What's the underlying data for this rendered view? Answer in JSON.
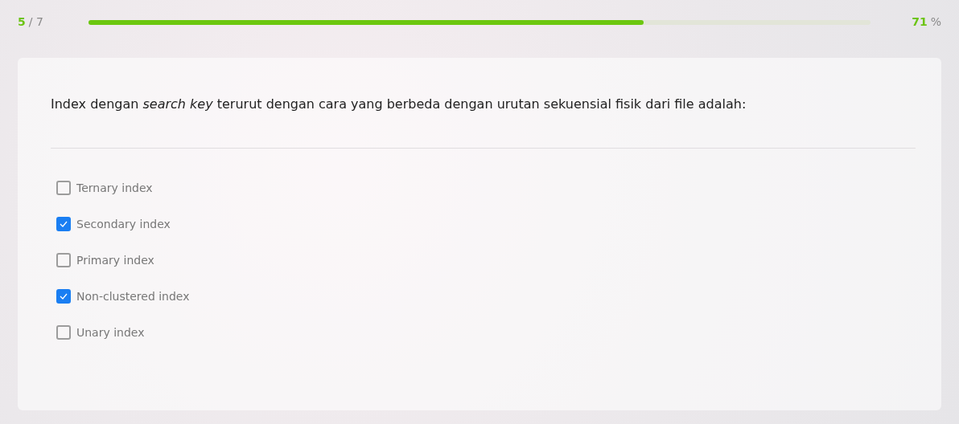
{
  "progress": {
    "current": "5",
    "total": "/ 7",
    "level": 0.71,
    "percent": "71",
    "percent_sign": "%"
  },
  "question": {
    "text": "Index dengan *search key* terurut dengan cara yang berbeda dengan urutan sekuensial fisik dari file adalah:"
  },
  "options": [
    {
      "label": "Ternary index",
      "checked": false
    },
    {
      "label": "Secondary index",
      "checked": true
    },
    {
      "label": "Primary index",
      "checked": false
    },
    {
      "label": "Non-clustered index",
      "checked": true
    },
    {
      "label": "Unary index",
      "checked": false
    }
  ]
}
